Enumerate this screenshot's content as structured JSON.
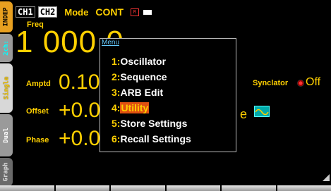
{
  "side_tabs": {
    "indep": "INDEP",
    "ch2": "2ch:",
    "single": "Single",
    "dual": "Dual",
    "graph": "Graph"
  },
  "header": {
    "ch1": "CH1",
    "ch2": "CH2",
    "mode_label": "Mode",
    "mode_value": "CONT",
    "remote_badge": "R"
  },
  "params": {
    "freq_label": "Freq",
    "freq_value": "1 000.0",
    "amptd_label": "Amptd",
    "amptd_value": "0.10",
    "offset_label": "Offset",
    "offset_value": "+0.0",
    "phase_label": "Phase",
    "phase_value": "+0.0",
    "synclator_label": "Synclator",
    "synclator_value": "Off",
    "wave_fragment": "e"
  },
  "menu": {
    "title": "Menu",
    "items": [
      {
        "num": "1:",
        "label": "Oscillator"
      },
      {
        "num": "2:",
        "label": "Sequence"
      },
      {
        "num": "3:",
        "label": "ARB Edit"
      },
      {
        "num": "4:",
        "label": "Utility"
      },
      {
        "num": "5:",
        "label": "Store Settings"
      },
      {
        "num": "6:",
        "label": "Recall Settings"
      }
    ],
    "selected_index": 3
  },
  "colors": {
    "accent": "#ffd000",
    "selection": "#e05010",
    "indep_tab": "#e8a020"
  }
}
